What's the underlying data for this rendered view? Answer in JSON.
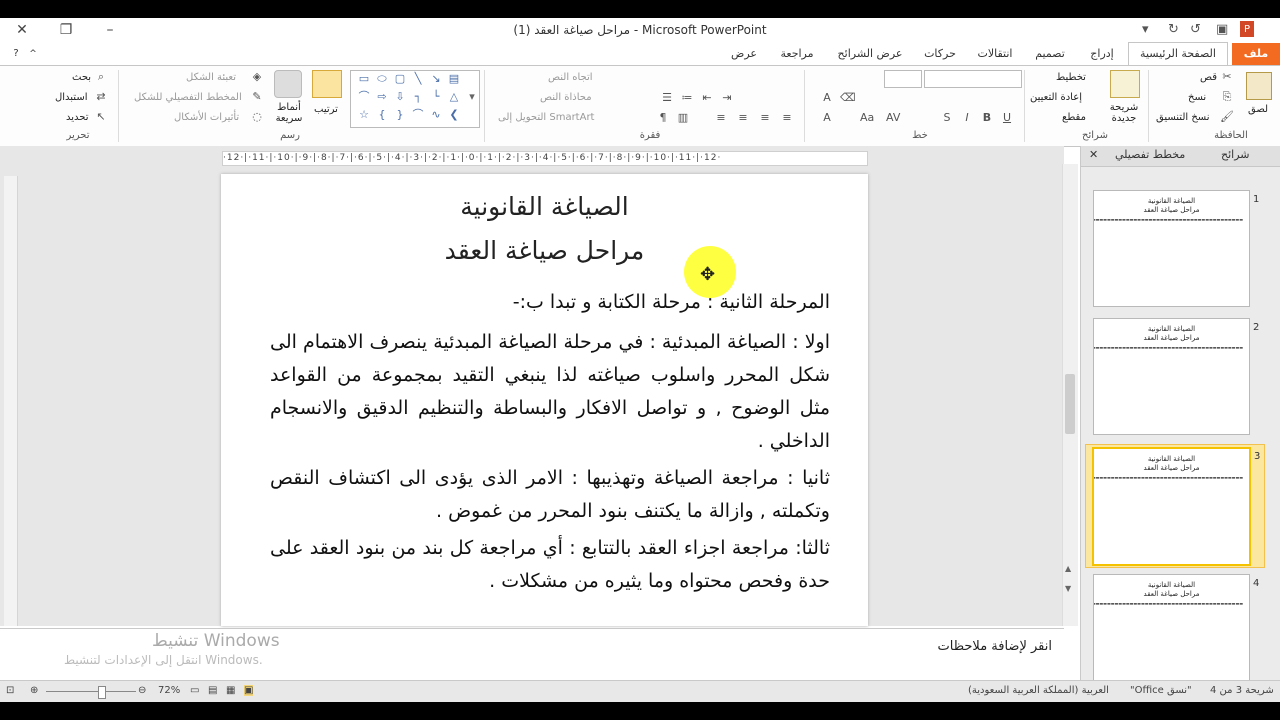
{
  "window": {
    "title": "مراحل صياغة العقد (1)  -  Microsoft PowerPoint"
  },
  "tabs": [
    {
      "label": "ملف",
      "key": "file"
    },
    {
      "label": "الصفحة الرئيسية",
      "key": "home"
    },
    {
      "label": "إدراج",
      "key": "insert"
    },
    {
      "label": "تصميم",
      "key": "design"
    },
    {
      "label": "انتقالات",
      "key": "transitions"
    },
    {
      "label": "حركات",
      "key": "animations"
    },
    {
      "label": "عرض الشرائح",
      "key": "slideshow"
    },
    {
      "label": "مراجعة",
      "key": "review"
    },
    {
      "label": "عرض",
      "key": "view"
    }
  ],
  "ribbon": {
    "clipboard": {
      "group": "الحافظة",
      "paste": "لصق",
      "cut": "قص",
      "copy": "نسخ",
      "format_painter": "نسخ التنسيق"
    },
    "slides": {
      "group": "شرائح",
      "new_slide": "شريحة جديدة",
      "layout": "تخطيط",
      "reset": "إعادة التعيين",
      "section": "مقطع"
    },
    "font": {
      "group": "خط"
    },
    "paragraph": {
      "group": "فقرة",
      "text_direction": "اتجاه النص",
      "align_text": "محاذاة النص",
      "smartart": "التحويل إلى SmartArt"
    },
    "drawing": {
      "group": "رسم",
      "arrange": "ترتيب",
      "quick_styles": "أنماط سريعة",
      "shape_fill": "تعبئة الشكل",
      "shape_outline": "المخطط التفصيلي للشكل",
      "shape_effects": "تأثيرات الأشكال"
    },
    "editing": {
      "group": "تحرير",
      "find": "بحث",
      "replace": "استبدال",
      "select": "تحديد"
    }
  },
  "ruler_text": "·12·|·11·|·10·|·9·|·8·|·7·|·6·|·5·|·4·|·3·|·2·|·1·|·0·|·1·|·2·|·3·|·4·|·5·|·6·|·7·|·8·|·9·|·10·|·11·|·12·",
  "slide": {
    "title_line1": "الصياغة القانونية",
    "title_line2": "مراحل صياغة العقد",
    "paragraphs": [
      "المرحلة الثانية : مرحلة الكتابة و تبدا ب:-",
      "اولا : الصياغة المبدئية : في مرحلة الصياغة المبدئية ينصرف الاهتمام الى شكل المحرر واسلوب صياغته لذا ينبغي التقيد بمجموعة من القواعد مثل الوضوح , و تواصل الافكار والبساطة والتنظيم الدقيق والانسجام الداخلي .",
      "ثانيا : مراجعة الصياغة وتهذيبها : الامر الذى يؤدى الى اكتشاف النقص وتكملته , وازالة ما يكتنف بنود المحرر من غموض .",
      "ثالثا: مراجعة اجزاء العقد بالتتابع : أي مراجعة كل بند من بنود العقد على حدة وفحص محتواه وما يثيره من مشكلات ."
    ]
  },
  "notes": {
    "placeholder": "انقر لإضافة ملاحظات",
    "activation_title": "تنشيط Windows",
    "activation_sub": "انتقل إلى الإعدادات لتنشيط Windows."
  },
  "pane": {
    "tab_slides": "شرائح",
    "tab_outline": "مخطط تفصيلي",
    "thumbnails": [
      {
        "num": "1",
        "t1": "الصياغة القانونية",
        "t2": "مراحل صياغة العقد"
      },
      {
        "num": "2",
        "t1": "الصياغة القانونية",
        "t2": "مراحل صياغة العقد"
      },
      {
        "num": "3",
        "t1": "الصياغة القانونية",
        "t2": "مراحل صياغة العقد"
      },
      {
        "num": "4",
        "t1": "الصياغة القانونية",
        "t2": "مراحل صياغة العقد"
      }
    ]
  },
  "status": {
    "slide_info": "شريحة 3 من 4",
    "theme": "\"نسق Office\"",
    "language": "العربية (المملكة العربية السعودية)",
    "zoom": "72%"
  },
  "colors": {
    "file_tab": "#f36b21",
    "highlight": "#ffff20",
    "active_thumb": "#f5c200"
  }
}
